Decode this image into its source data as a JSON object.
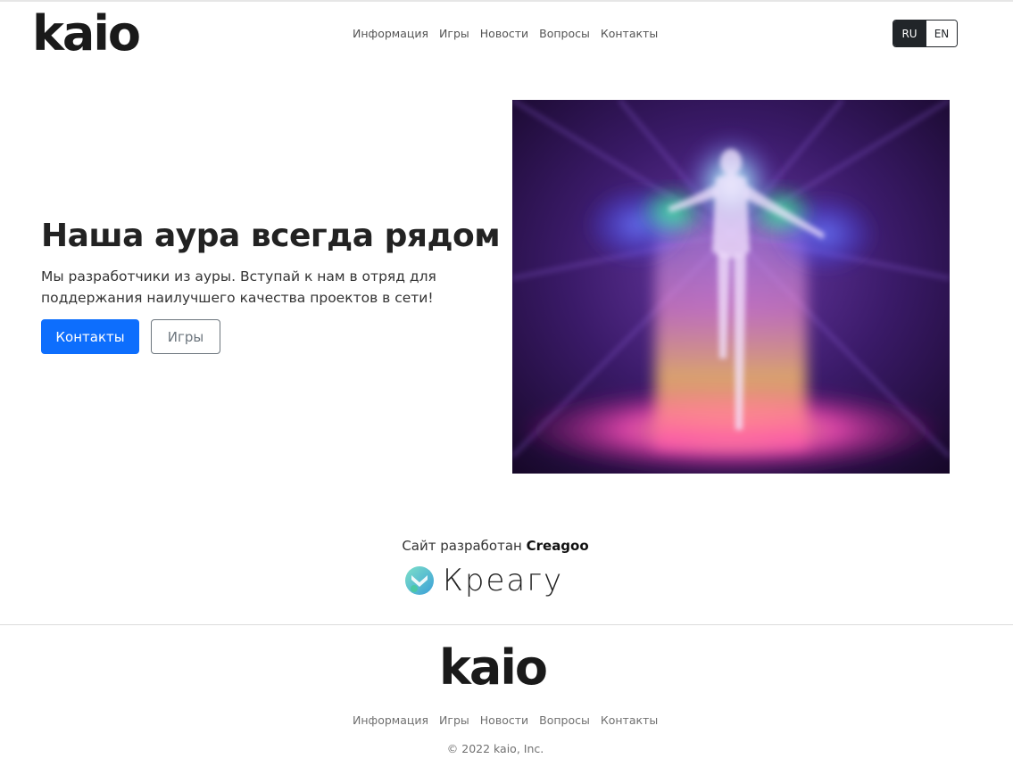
{
  "header": {
    "logo": "kaio",
    "nav": [
      "Информация",
      "Игры",
      "Новости",
      "Вопросы",
      "Контакты"
    ],
    "lang": {
      "active": "RU",
      "other": "EN"
    }
  },
  "hero": {
    "title": "Наша аура всегда рядом",
    "text": "Мы разработчики из ауры. Вступай к нам в отряд для поддержания наилучшего качества проектов в сети!",
    "primary_button": "Контакты",
    "secondary_button": "Игры"
  },
  "credit": {
    "prefix": "Сайт разработан",
    "brand": "Creagoo",
    "logo_text": "Креагу"
  },
  "footer": {
    "logo": "kaio",
    "nav": [
      "Информация",
      "Игры",
      "Новости",
      "Вопросы",
      "Контакты"
    ],
    "copyright": "© 2022 kaio, Inc."
  },
  "colors": {
    "primary": "#0d6efd",
    "dark": "#212529",
    "muted": "#6c757d"
  }
}
